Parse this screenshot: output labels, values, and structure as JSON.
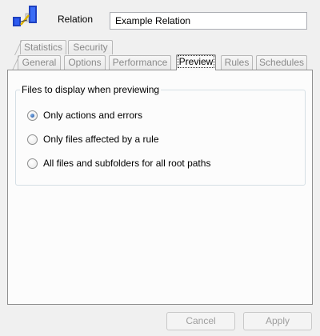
{
  "header": {
    "name_label": "Relation",
    "name_value": "Example Relation",
    "icon": "relation-icon"
  },
  "tabs": {
    "row1": [
      {
        "label": "Statistics"
      },
      {
        "label": "Security"
      }
    ],
    "row2": [
      {
        "label": "General"
      },
      {
        "label": "Options"
      },
      {
        "label": "Performance"
      },
      {
        "label": "Preview"
      },
      {
        "label": "Rules"
      },
      {
        "label": "Schedules"
      }
    ],
    "active": "Preview"
  },
  "preview": {
    "group_title": "Files to display when previewing",
    "options": [
      {
        "label": "Only actions and errors",
        "checked": true
      },
      {
        "label": "Only files affected by a rule",
        "checked": false
      },
      {
        "label": "All files and subfolders for all root paths",
        "checked": false
      }
    ]
  },
  "buttons": {
    "cancel": "Cancel",
    "apply": "Apply"
  }
}
